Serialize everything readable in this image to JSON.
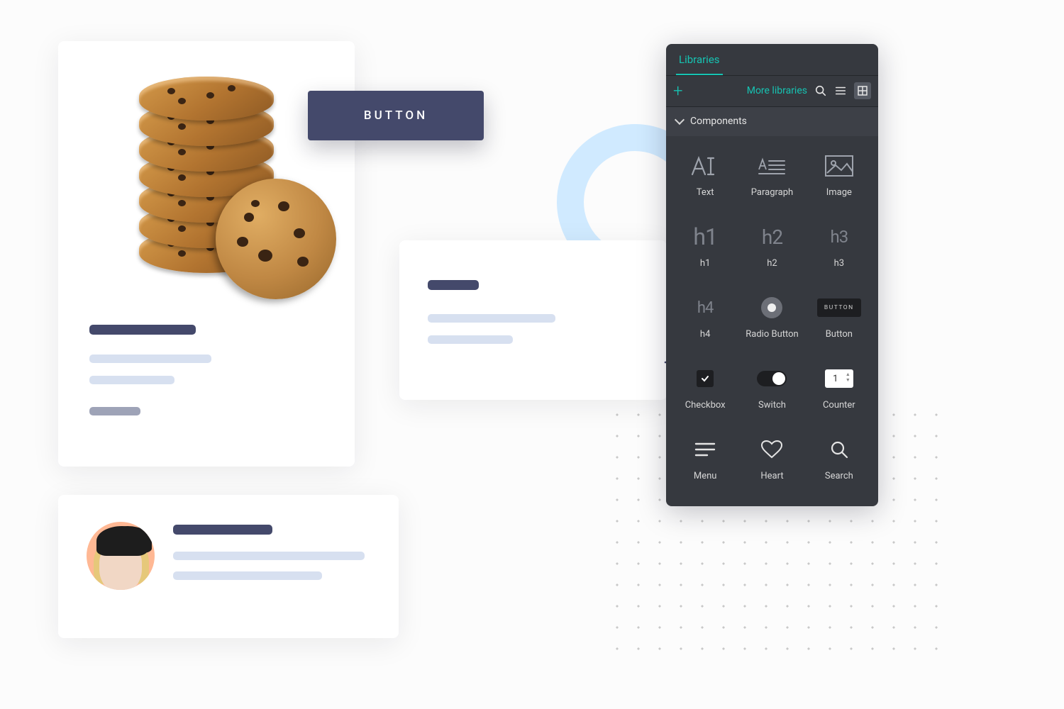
{
  "sample_button_label": "BUTTON",
  "panel": {
    "tab_label": "Libraries",
    "more_libraries_label": "More libraries",
    "section_label": "Components",
    "items": [
      {
        "label": "Text"
      },
      {
        "label": "Paragraph"
      },
      {
        "label": "Image"
      },
      {
        "label": "h1",
        "glyph": "h1"
      },
      {
        "label": "h2",
        "glyph": "h2"
      },
      {
        "label": "h3",
        "glyph": "h3"
      },
      {
        "label": "h4",
        "glyph": "h4"
      },
      {
        "label": "Radio Button"
      },
      {
        "label": "Button",
        "glyph": "BUTTON"
      },
      {
        "label": "Checkbox"
      },
      {
        "label": "Switch"
      },
      {
        "label": "Counter",
        "value": "1"
      },
      {
        "label": "Menu"
      },
      {
        "label": "Heart"
      },
      {
        "label": "Search"
      }
    ]
  },
  "colors": {
    "navy": "#44496b",
    "teal": "#16c3b2",
    "panel": "#36393f"
  }
}
